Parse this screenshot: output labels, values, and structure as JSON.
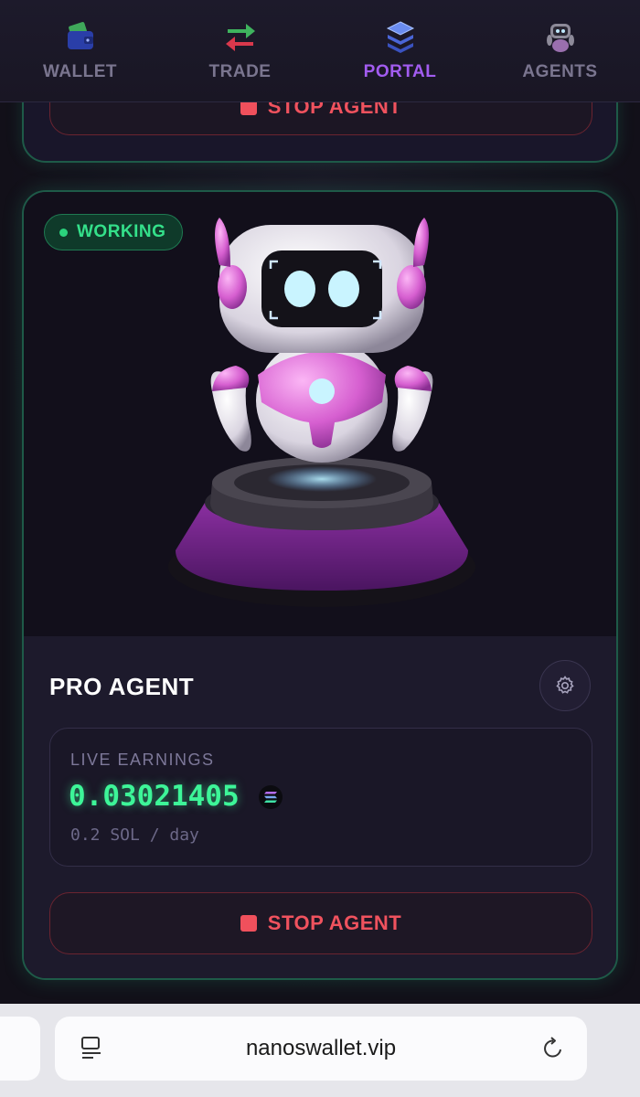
{
  "nav": {
    "items": [
      {
        "label": "WALLET",
        "icon": "wallet-icon"
      },
      {
        "label": "TRADE",
        "icon": "trade-arrows-icon"
      },
      {
        "label": "PORTAL",
        "icon": "portal-layers-icon",
        "active": true
      },
      {
        "label": "AGENTS",
        "icon": "robot-icon"
      }
    ]
  },
  "previous_card": {
    "stop_label": "STOP AGENT"
  },
  "agent_card": {
    "status": "WORKING",
    "name": "PRO AGENT",
    "earnings_label": "LIVE EARNINGS",
    "earnings_value": "0.03021405",
    "earnings_currency_icon": "solana-icon",
    "rate": "0.2 SOL / day",
    "stop_label": "STOP AGENT"
  },
  "browser": {
    "url": "nanoswallet.vip"
  },
  "colors": {
    "accent_purple": "#a25cf0",
    "working_green": "#34e08a",
    "earnings_green": "#3df598",
    "stop_red": "#f0525e",
    "card_border": "#1e5a48"
  }
}
